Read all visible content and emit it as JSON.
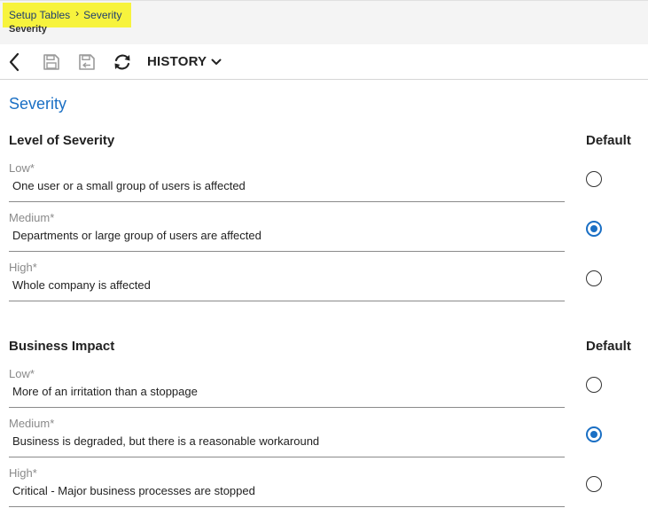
{
  "breadcrumb": {
    "items": [
      "Setup Tables",
      "Severity"
    ]
  },
  "page": {
    "subtitle": "Severity",
    "title": "Severity"
  },
  "toolbar": {
    "history_label": "HISTORY",
    "icons": [
      "back-icon",
      "save-icon",
      "save-close-icon",
      "refresh-icon",
      "chevron-down-icon"
    ]
  },
  "sections": [
    {
      "title": "Level of Severity",
      "default_header": "Default",
      "rows": [
        {
          "label": "Low*",
          "value": "One user or a small group of users is affected",
          "default": false
        },
        {
          "label": "Medium*",
          "value": "Departments or large group of users are affected",
          "default": true
        },
        {
          "label": "High*",
          "value": "Whole company is affected",
          "default": false
        }
      ]
    },
    {
      "title": "Business Impact",
      "default_header": "Default",
      "rows": [
        {
          "label": "Low*",
          "value": "More of an irritation than a stoppage",
          "default": false
        },
        {
          "label": "Medium*",
          "value": "Business is degraded, but there is a reasonable workaround",
          "default": true
        },
        {
          "label": "High*",
          "value": "Critical - Major business processes are stopped",
          "default": false
        }
      ]
    }
  ],
  "colors": {
    "accent": "#1a6fc4",
    "highlight": "#f7f33d",
    "header_bg": "#f4f4f4"
  }
}
